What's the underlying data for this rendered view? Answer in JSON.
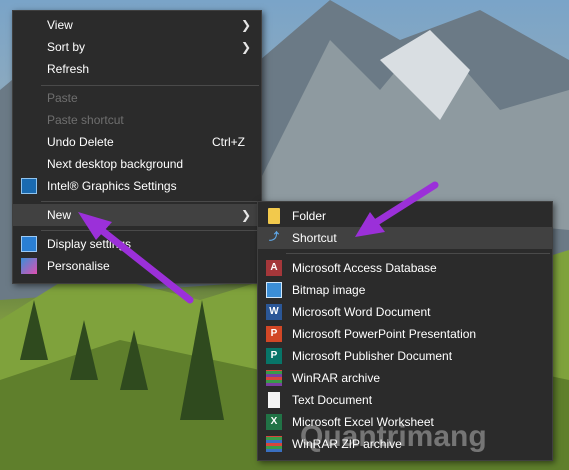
{
  "context_menu": {
    "items": [
      {
        "label": "View",
        "submenu": true
      },
      {
        "label": "Sort by",
        "submenu": true
      },
      {
        "label": "Refresh"
      },
      {
        "label": "Paste",
        "disabled": true
      },
      {
        "label": "Paste shortcut",
        "disabled": true
      },
      {
        "label": "Undo Delete",
        "accelerator": "Ctrl+Z"
      },
      {
        "label": "Next desktop background"
      },
      {
        "label": "Intel® Graphics Settings",
        "icon": "intel-graphics-icon"
      },
      {
        "label": "New",
        "submenu": true,
        "highlighted": true
      },
      {
        "label": "Display settings",
        "icon": "display-icon"
      },
      {
        "label": "Personalise",
        "icon": "personalise-icon"
      }
    ]
  },
  "new_submenu": {
    "items": [
      {
        "label": "Folder",
        "icon": "folder-icon"
      },
      {
        "label": "Shortcut",
        "icon": "shortcut-icon",
        "highlighted": true
      },
      {
        "label": "Microsoft Access Database",
        "icon": "access-icon"
      },
      {
        "label": "Bitmap image",
        "icon": "bitmap-icon"
      },
      {
        "label": "Microsoft Word Document",
        "icon": "word-icon"
      },
      {
        "label": "Microsoft PowerPoint Presentation",
        "icon": "powerpoint-icon"
      },
      {
        "label": "Microsoft Publisher Document",
        "icon": "publisher-icon"
      },
      {
        "label": "WinRAR archive",
        "icon": "winrar-icon"
      },
      {
        "label": "Text Document",
        "icon": "text-document-icon"
      },
      {
        "label": "Microsoft Excel Worksheet",
        "icon": "excel-icon"
      },
      {
        "label": "WinRAR ZIP archive",
        "icon": "winrar-zip-icon"
      }
    ]
  },
  "watermark": {
    "text": "Quantrimang"
  },
  "colors": {
    "menu_bg": "#2b2b2b",
    "highlight": "#414141",
    "annotation_arrow": "#9b30d9"
  }
}
